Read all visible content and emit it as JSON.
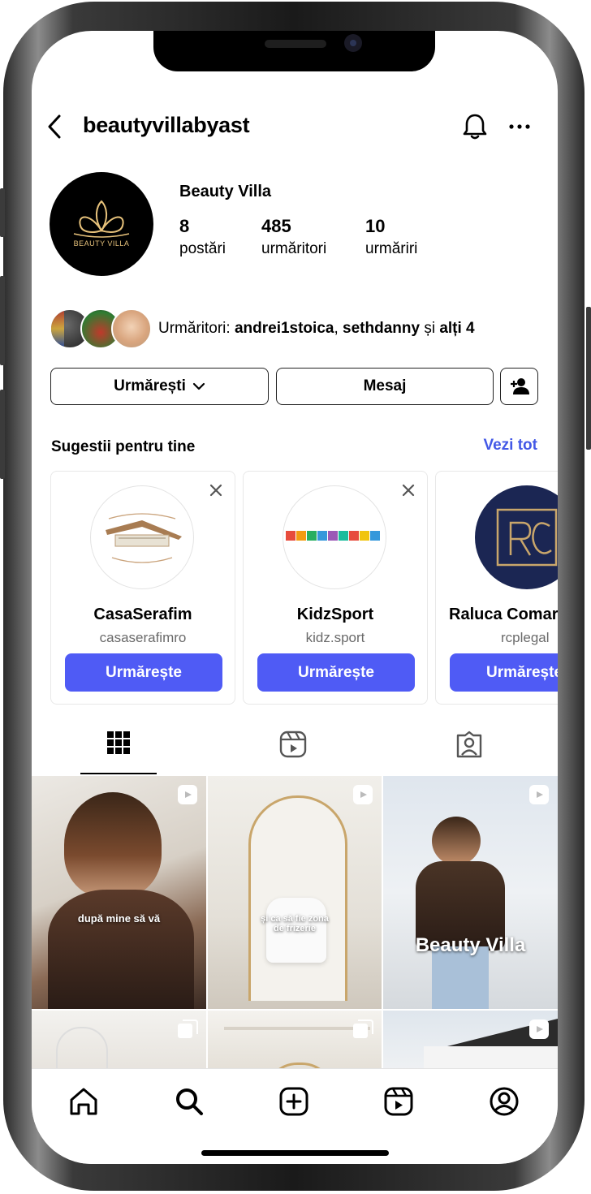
{
  "header": {
    "username": "beautyvillabyast"
  },
  "profile": {
    "display_name": "Beauty Villa",
    "avatar_text": "BEAUTY VILLA",
    "stats": [
      {
        "value": "8",
        "label": "postări"
      },
      {
        "value": "485",
        "label": "urmăritori"
      },
      {
        "value": "10",
        "label": "urmăriri"
      }
    ]
  },
  "followers": {
    "prefix": "Urmăritori: ",
    "name1": "andrei1stoica",
    "separator": ", ",
    "name2": "sethdanny",
    "conjunction": " și ",
    "others": "alți 4"
  },
  "actions": {
    "following_label": "Urmărești",
    "message_label": "Mesaj"
  },
  "suggestions": {
    "title": "Sugestii pentru tine",
    "see_all": "Vezi tot",
    "items": [
      {
        "name": "CasaSerafim",
        "handle": "casaserafimro",
        "follow_label": "Urmărește"
      },
      {
        "name": "KidzSport",
        "handle": "kidz.sport",
        "follow_label": "Urmărește"
      },
      {
        "name": "Raluca Comar",
        "handle": "rcplegal",
        "follow_label": "Urmărește"
      }
    ]
  },
  "posts": {
    "captions": [
      "după mine să vă",
      "și ca să fie zona de frizerie",
      "Beauty Villa"
    ]
  },
  "colors": {
    "accent": "#4f5bf5",
    "link": "#4358e6"
  }
}
